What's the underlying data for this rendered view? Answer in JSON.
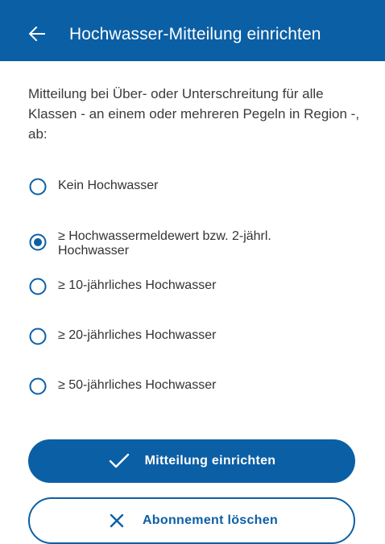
{
  "header": {
    "back_icon": "arrow-left-icon",
    "title": "Hochwasser-Mitteilung einrichten",
    "background_color": "#0b5fa5"
  },
  "intro_text": "Mitteilung bei Über- oder Unterschreitung für alle Klassen - an einem oder mehreren Pegeln in Region -, ab:",
  "options": [
    {
      "label": "Kein Hochwasser",
      "selected": false
    },
    {
      "label": "≥ Hochwassermeldewert bzw. 2-jährl. Hochwasser",
      "selected": true
    },
    {
      "label": "≥ 10-jährliches Hochwasser",
      "selected": false
    },
    {
      "label": "≥ 20-jährliches Hochwasser",
      "selected": false
    },
    {
      "label": "≥ 50-jährliches Hochwasser",
      "selected": false
    }
  ],
  "actions": {
    "primary_label": "Mitteilung einrichten",
    "primary_icon": "check-icon",
    "secondary_label": "Abonnement löschen",
    "secondary_icon": "close-icon"
  },
  "colors": {
    "accent": "#0b5fa5",
    "text": "#333333",
    "background": "#ffffff"
  }
}
